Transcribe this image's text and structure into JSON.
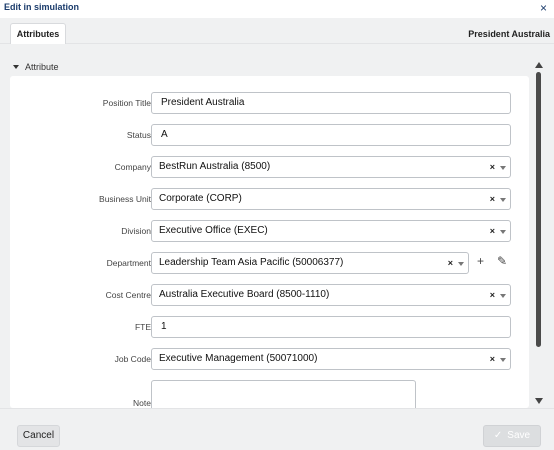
{
  "dialog": {
    "title": "Edit in simulation",
    "close_glyph": "×"
  },
  "tabs": [
    {
      "label": "Attributes",
      "active": true
    }
  ],
  "header": {
    "position_name": "President Australia"
  },
  "section": {
    "title": "Attribute"
  },
  "fields": {
    "position_title": {
      "label": "Position Title",
      "value": "President Australia"
    },
    "status": {
      "label": "Status",
      "value": "A"
    },
    "company": {
      "label": "Company",
      "value": "BestRun Australia (8500)"
    },
    "business_unit": {
      "label": "Business Unit",
      "value": "Corporate (CORP)"
    },
    "division": {
      "label": "Division",
      "value": "Executive Office (EXEC)"
    },
    "department": {
      "label": "Department",
      "value": "Leadership Team Asia Pacific (50006377)"
    },
    "cost_centre": {
      "label": "Cost Centre",
      "value": "Australia Executive Board (8500-1110)"
    },
    "fte": {
      "label": "FTE",
      "value": "1"
    },
    "job_code": {
      "label": "Job Code",
      "value": "Executive Management (50071000)"
    },
    "note": {
      "label": "Note",
      "value": ""
    }
  },
  "glyphs": {
    "clear": "×",
    "add": "+",
    "edit": "✎",
    "check": "✓"
  },
  "footer": {
    "cancel_label": "Cancel",
    "save_label": "Save"
  },
  "colors": {
    "title": "#1a3b6b",
    "background": "#f0f1f2",
    "border": "#bfc3c8"
  }
}
